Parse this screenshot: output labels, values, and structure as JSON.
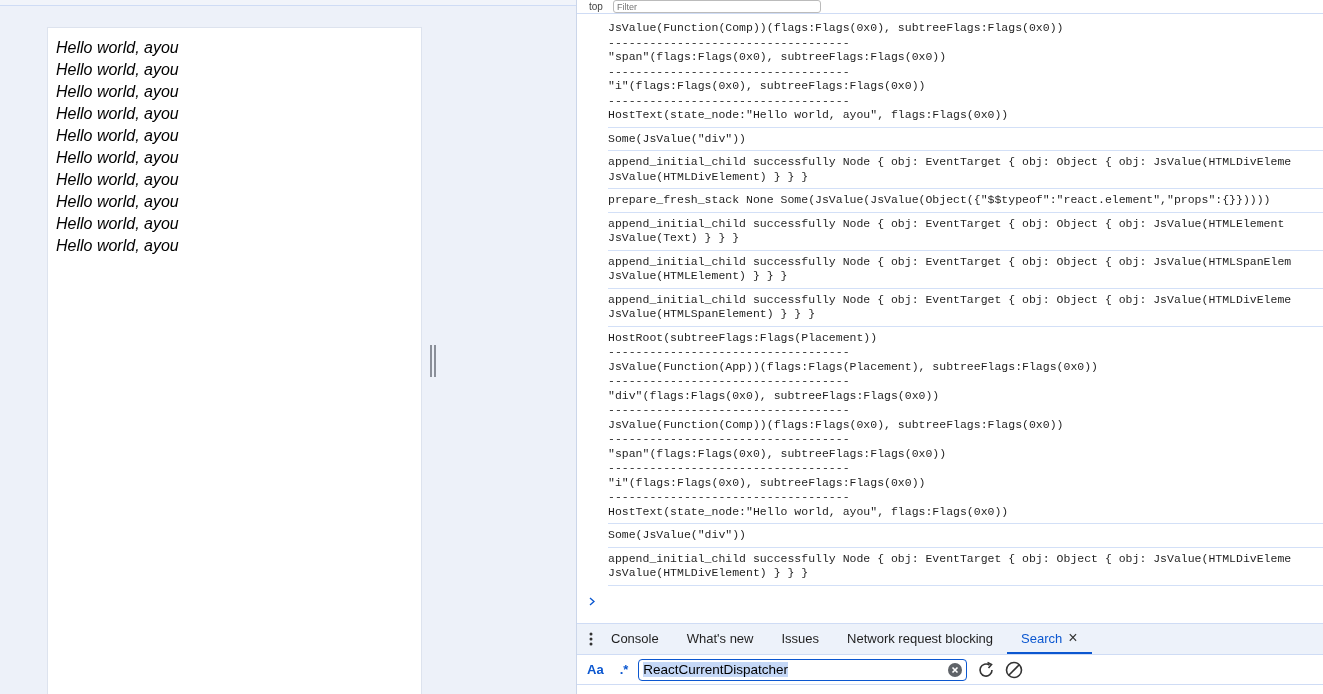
{
  "preview": {
    "lines": [
      "Hello world, ayou",
      "Hello world, ayou",
      "Hello world, ayou",
      "Hello world, ayou",
      "Hello world, ayou",
      "Hello world, ayou",
      "Hello world, ayou",
      "Hello world, ayou",
      "Hello world, ayou",
      "Hello world, ayou"
    ]
  },
  "toolbar": {
    "context": "top",
    "filter_placeholder": "Filter"
  },
  "console": {
    "messages": [
      {
        "lines": [
          "JsValue(Function(Comp))(flags:Flags(0x0), subtreeFlags:Flags(0x0))",
          "-----------------------------------",
          "\"span\"(flags:Flags(0x0), subtreeFlags:Flags(0x0))",
          "-----------------------------------",
          "\"i\"(flags:Flags(0x0), subtreeFlags:Flags(0x0))",
          "-----------------------------------",
          "HostText(state_node:\"Hello world, ayou\", flags:Flags(0x0))"
        ]
      },
      {
        "lines": [
          "Some(JsValue(\"div\"))"
        ]
      },
      {
        "lines": [
          "append_initial_child successfully Node { obj: EventTarget { obj: Object { obj: JsValue(HTMLDivEleme",
          "JsValue(HTMLDivElement) } } }"
        ]
      },
      {
        "lines": [
          "prepare_fresh_stack None Some(JsValue(JsValue(Object({\"$$typeof\":\"react.element\",\"props\":{}}))))"
        ]
      },
      {
        "lines": [
          "append_initial_child successfully Node { obj: EventTarget { obj: Object { obj: JsValue(HTMLElement",
          "JsValue(Text) } } }"
        ]
      },
      {
        "lines": [
          "append_initial_child successfully Node { obj: EventTarget { obj: Object { obj: JsValue(HTMLSpanElem",
          "JsValue(HTMLElement) } } }"
        ]
      },
      {
        "lines": [
          "append_initial_child successfully Node { obj: EventTarget { obj: Object { obj: JsValue(HTMLDivEleme",
          "JsValue(HTMLSpanElement) } } }"
        ]
      },
      {
        "lines": [
          "HostRoot(subtreeFlags:Flags(Placement))",
          "-----------------------------------",
          "JsValue(Function(App))(flags:Flags(Placement), subtreeFlags:Flags(0x0))",
          "-----------------------------------",
          "\"div\"(flags:Flags(0x0), subtreeFlags:Flags(0x0))",
          "-----------------------------------",
          "JsValue(Function(Comp))(flags:Flags(0x0), subtreeFlags:Flags(0x0))",
          "-----------------------------------",
          "\"span\"(flags:Flags(0x0), subtreeFlags:Flags(0x0))",
          "-----------------------------------",
          "\"i\"(flags:Flags(0x0), subtreeFlags:Flags(0x0))",
          "-----------------------------------",
          "HostText(state_node:\"Hello world, ayou\", flags:Flags(0x0))"
        ]
      },
      {
        "lines": [
          "Some(JsValue(\"div\"))"
        ]
      },
      {
        "lines": [
          "append_initial_child successfully Node { obj: EventTarget { obj: Object { obj: JsValue(HTMLDivEleme",
          "JsValue(HTMLDivElement) } } }"
        ]
      }
    ]
  },
  "drawer": {
    "tabs": [
      {
        "label": "Console",
        "selected": false,
        "closable": false
      },
      {
        "label": "What's new",
        "selected": false,
        "closable": false
      },
      {
        "label": "Issues",
        "selected": false,
        "closable": false
      },
      {
        "label": "Network request blocking",
        "selected": false,
        "closable": false
      },
      {
        "label": "Search",
        "selected": true,
        "closable": true
      }
    ],
    "close_glyph": "×"
  },
  "search": {
    "case_toggle": "Aa",
    "regex_toggle": ".*",
    "value": "ReactCurrentDispatcher"
  }
}
